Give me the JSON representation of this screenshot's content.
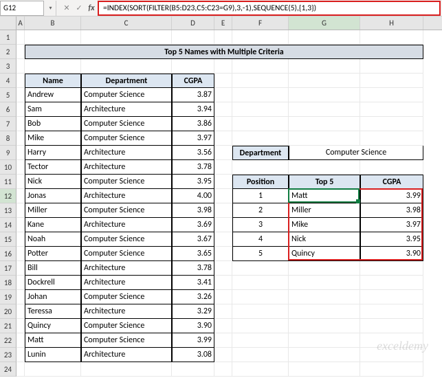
{
  "cellRef": "G12",
  "formula": "=INDEX(SORT(FILTER(B5:D23,C5:C23=G9),3,-1),SEQUENCE(5),{1,3})",
  "columns": [
    "A",
    "B",
    "C",
    "D",
    "E",
    "F",
    "G",
    "H"
  ],
  "title": "Top 5 Names with Multiple Criteria",
  "mainHeaders": {
    "name": "Name",
    "dept": "Department",
    "cgpa": "CGPA"
  },
  "mainRows": [
    {
      "name": "Andrew",
      "dept": "Computer Science",
      "cgpa": "3.87"
    },
    {
      "name": "Sam",
      "dept": "Architecture",
      "cgpa": "3.94"
    },
    {
      "name": "Bob",
      "dept": "Computer Science",
      "cgpa": "3.86"
    },
    {
      "name": "Mike",
      "dept": "Computer Science",
      "cgpa": "3.97"
    },
    {
      "name": "Harry",
      "dept": "Architecture",
      "cgpa": "3.56"
    },
    {
      "name": "Tector",
      "dept": "Architecture",
      "cgpa": "3.78"
    },
    {
      "name": "Nick",
      "dept": "Computer Science",
      "cgpa": "3.95"
    },
    {
      "name": "Jonas",
      "dept": "Architecture",
      "cgpa": "4.00"
    },
    {
      "name": "Miller",
      "dept": "Computer Science",
      "cgpa": "3.98"
    },
    {
      "name": "Kane",
      "dept": "Architecture",
      "cgpa": "3.69"
    },
    {
      "name": "Noah",
      "dept": "Computer Science",
      "cgpa": "3.67"
    },
    {
      "name": "Potter",
      "dept": "Computer Science",
      "cgpa": "3.65"
    },
    {
      "name": "Bill",
      "dept": "Architecture",
      "cgpa": "3.78"
    },
    {
      "name": "Dockrell",
      "dept": "Architecture",
      "cgpa": "3.41"
    },
    {
      "name": "Johan",
      "dept": "Computer Science",
      "cgpa": "3.26"
    },
    {
      "name": "Teressa",
      "dept": "Architecture",
      "cgpa": "3.29"
    },
    {
      "name": "Quincy",
      "dept": "Computer Science",
      "cgpa": "3.90"
    },
    {
      "name": "Matt",
      "dept": "Computer Science",
      "cgpa": "3.99"
    },
    {
      "name": "Lunin",
      "dept": "Architecture",
      "cgpa": "3.08"
    }
  ],
  "filter": {
    "label": "Department",
    "value": "Computer Science"
  },
  "resultHeaders": {
    "pos": "Position",
    "top": "Top 5",
    "cgpa": "CGPA"
  },
  "resultRows": [
    {
      "pos": "1",
      "top": "Matt",
      "cgpa": "3.99"
    },
    {
      "pos": "2",
      "top": "Miller",
      "cgpa": "3.98"
    },
    {
      "pos": "3",
      "top": "Mike",
      "cgpa": "3.97"
    },
    {
      "pos": "4",
      "top": "Nick",
      "cgpa": "3.95"
    },
    {
      "pos": "5",
      "top": "Quincy",
      "cgpa": "3.90"
    }
  ],
  "watermark": "exceldemy"
}
